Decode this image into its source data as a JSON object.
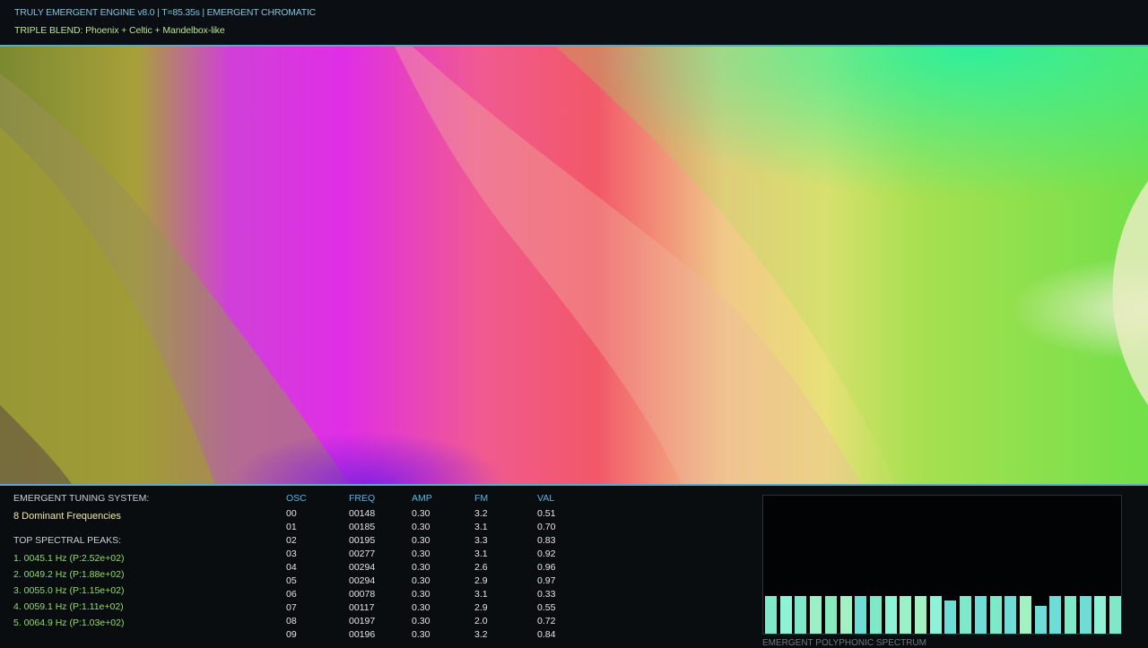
{
  "header": {
    "line1": "TRULY EMERGENT ENGINE v8.0 | T=85.35s | EMERGENT CHROMATIC",
    "line2": "TRIPLE BLEND: Phoenix + Celtic + Mandelbox-like"
  },
  "tuning": {
    "title": "EMERGENT TUNING SYSTEM:",
    "count": "8 Dominant Frequencies",
    "peaks_title": "TOP SPECTRAL PEAKS:",
    "peaks": [
      "1. 0045.1 Hz (P:2.52e+02)",
      "2. 0049.2 Hz (P:1.88e+02)",
      "3. 0055.0 Hz (P:1.15e+02)",
      "4. 0059.1 Hz (P:1.11e+02)",
      "5. 0064.9 Hz (P:1.03e+02)"
    ]
  },
  "oscillators": {
    "headers": {
      "osc": "OSC",
      "freq": "FREQ",
      "amp": "AMP",
      "fm": "FM",
      "val": "VAL"
    },
    "rows": [
      {
        "osc": "00",
        "freq": "00148",
        "amp": "0.30",
        "fm": "3.2",
        "val": "0.51"
      },
      {
        "osc": "01",
        "freq": "00185",
        "amp": "0.30",
        "fm": "3.1",
        "val": "0.70"
      },
      {
        "osc": "02",
        "freq": "00195",
        "amp": "0.30",
        "fm": "3.3",
        "val": "0.83"
      },
      {
        "osc": "03",
        "freq": "00277",
        "amp": "0.30",
        "fm": "3.1",
        "val": "0.92"
      },
      {
        "osc": "04",
        "freq": "00294",
        "amp": "0.30",
        "fm": "2.6",
        "val": "0.96"
      },
      {
        "osc": "05",
        "freq": "00294",
        "amp": "0.30",
        "fm": "2.9",
        "val": "0.97"
      },
      {
        "osc": "06",
        "freq": "00078",
        "amp": "0.30",
        "fm": "3.1",
        "val": "0.33"
      },
      {
        "osc": "07",
        "freq": "00117",
        "amp": "0.30",
        "fm": "2.9",
        "val": "0.55"
      },
      {
        "osc": "08",
        "freq": "00197",
        "amp": "0.30",
        "fm": "2.0",
        "val": "0.72"
      },
      {
        "osc": "09",
        "freq": "00196",
        "amp": "0.30",
        "fm": "3.2",
        "val": "0.84"
      }
    ]
  },
  "spectrum": {
    "label": "EMERGENT POLYPHONIC SPECTRUM",
    "levels": [
      0.28,
      0.28,
      0.28,
      0.28,
      0.28,
      0.28,
      0.28,
      0.28,
      0.28,
      0.28,
      0.28,
      0.28,
      0.245,
      0.28,
      0.28,
      0.28,
      0.28,
      0.28,
      0.205,
      0.28,
      0.28,
      0.28,
      0.28,
      0.28
    ],
    "colors": [
      "#7fe8c8",
      "#8ef3d6",
      "#7fe8c8",
      "#9cf0c6",
      "#88e8c0",
      "#a2f1c2",
      "#6fdcd6",
      "#7fe8c8",
      "#8ef3d6",
      "#9cf0c6",
      "#a2f1c2",
      "#8ef3d6",
      "#6fdcd6",
      "#7fe8c8",
      "#6fdcd6",
      "#7fe8c8",
      "#6fdcd6",
      "#a2f1c2",
      "#6fdcd6",
      "#6fdcd6",
      "#7fe8c8",
      "#6fdcd6",
      "#8ef3d6",
      "#7fe8c8"
    ]
  },
  "theme": {
    "accent": "#5fa8c8",
    "header_text": "#7fc4e0",
    "subtitle_text": "#b8e39a",
    "peak_text": "#8fdc6a",
    "column_header": "#5fb3e0"
  }
}
